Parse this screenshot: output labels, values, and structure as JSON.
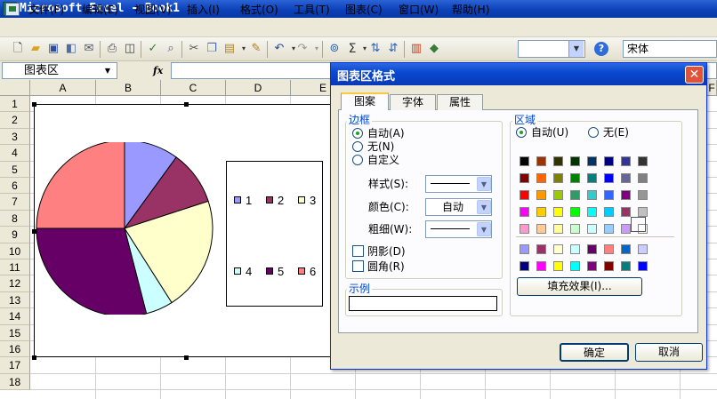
{
  "window": {
    "title": "Microsoft Excel - Book1",
    "app_icon_glyph": "X"
  },
  "menu": [
    {
      "label": "文件(F)"
    },
    {
      "label": "编辑(E)"
    },
    {
      "label": "视图(V)"
    },
    {
      "label": "插入(I)"
    },
    {
      "label": "格式(O)"
    },
    {
      "label": "工具(T)"
    },
    {
      "label": "图表(C)"
    },
    {
      "label": "窗口(W)"
    },
    {
      "label": "帮助(H)"
    }
  ],
  "toolbar": {
    "zoom_value": "",
    "font_name": "宋体",
    "sum_glyph": "Σ",
    "help_glyph": "?"
  },
  "formula_bar": {
    "name_box": "图表区",
    "fx_label": "fx",
    "formula": ""
  },
  "columns": [
    "A",
    "B",
    "C",
    "D",
    "E",
    "F"
  ],
  "rows": [
    "1",
    "2",
    "3",
    "4",
    "5",
    "6",
    "7",
    "8",
    "9",
    "10",
    "11",
    "12",
    "13",
    "14",
    "15",
    "16",
    "17",
    "18"
  ],
  "chart_data": {
    "type": "pie",
    "categories": [
      "1",
      "2",
      "3",
      "4",
      "5",
      "6"
    ],
    "values": [
      10,
      10,
      21,
      5,
      29,
      25
    ],
    "colors": [
      "#9999ff",
      "#993366",
      "#ffffcc",
      "#ccffff",
      "#660066",
      "#ff8080"
    ],
    "legend_position": "right"
  },
  "dialog": {
    "title": "图表区格式",
    "close_glyph": "✕",
    "tabs": [
      {
        "label": "图案",
        "active": true
      },
      {
        "label": "字体",
        "active": false
      },
      {
        "label": "属性",
        "active": false
      }
    ],
    "border": {
      "title": "边框",
      "options": [
        {
          "label": "自动(A)",
          "selected": true
        },
        {
          "label": "无(N)",
          "selected": false
        },
        {
          "label": "自定义",
          "selected": false
        }
      ],
      "style_label": "样式(S):",
      "color_label": "颜色(C):",
      "color_value": "自动",
      "weight_label": "粗细(W):",
      "shadow_label": "阴影(D)",
      "shadow_checked": false,
      "round_label": "圆角(R)",
      "round_checked": false
    },
    "area": {
      "title": "区域",
      "auto_label": "自动(U)",
      "auto_selected": true,
      "none_label": "无(E)",
      "none_selected": false,
      "palette": [
        [
          "#000000",
          "#993300",
          "#333300",
          "#003300",
          "#003366",
          "#000080",
          "#333399",
          "#333333"
        ],
        [
          "#800000",
          "#ff6600",
          "#808000",
          "#008000",
          "#008080",
          "#0000ff",
          "#666699",
          "#808080"
        ],
        [
          "#ff0000",
          "#ff9900",
          "#99cc00",
          "#339966",
          "#33cccc",
          "#3366ff",
          "#800080",
          "#969696"
        ],
        [
          "#ff00ff",
          "#ffcc00",
          "#ffff00",
          "#00ff00",
          "#00ffff",
          "#00ccff",
          "#993366",
          "#c0c0c0"
        ],
        [
          "#ff99cc",
          "#ffcc99",
          "#ffff99",
          "#ccffcc",
          "#ccffff",
          "#99ccff",
          "#cc99ff",
          "#ffffff"
        ]
      ],
      "palette2": [
        [
          "#9999ff",
          "#993366",
          "#ffffcc",
          "#ccffff",
          "#660066",
          "#ff8080",
          "#0066cc",
          "#ccccff"
        ],
        [
          "#000080",
          "#ff00ff",
          "#ffff00",
          "#00ffff",
          "#800080",
          "#800000",
          "#008080",
          "#0000ff"
        ]
      ],
      "fill_effects_label": "填充效果(I)..."
    },
    "sample_title": "示例",
    "ok_label": "确定",
    "cancel_label": "取消"
  }
}
